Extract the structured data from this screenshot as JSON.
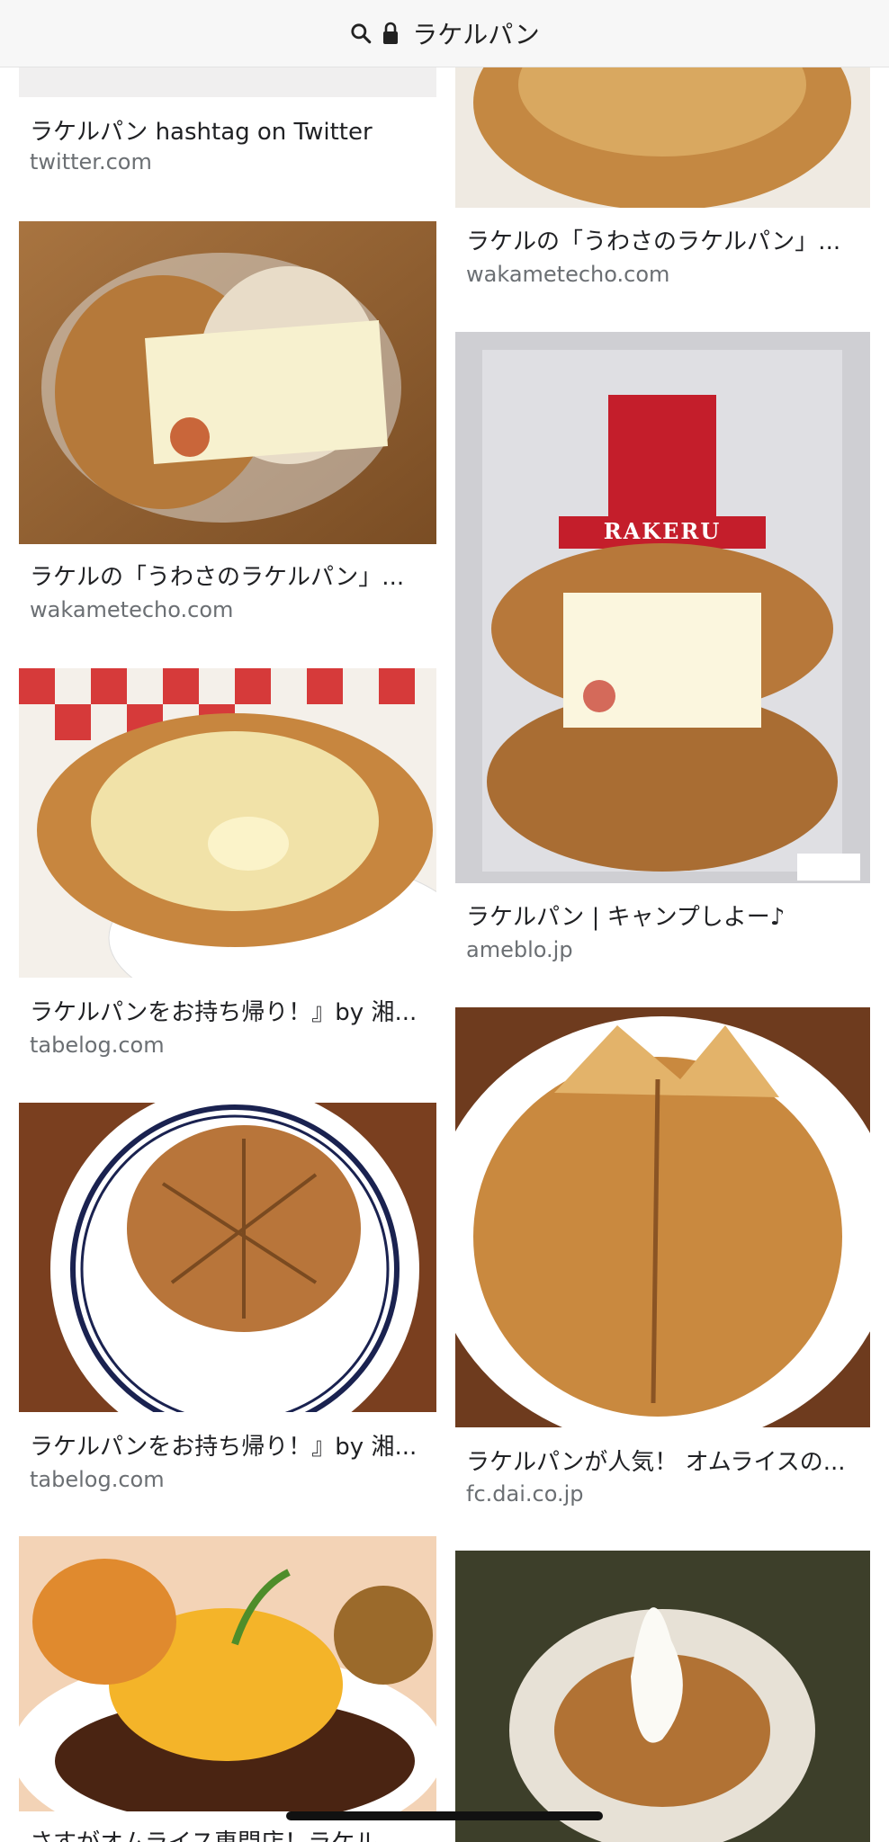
{
  "search": {
    "query": "ラケルパン"
  },
  "results": [
    {
      "title": "ラケルパン hashtag on Twitter",
      "site": "twitter.com"
    },
    {
      "title": "ラケルの「うわさのラケルパン」...",
      "site": "wakametecho.com"
    },
    {
      "title": "ラケルの「うわさのラケルパン」...",
      "site": "wakametecho.com"
    },
    {
      "title": "ラケルパン | キャンプしよー♪",
      "site": "ameblo.jp"
    },
    {
      "title": "ラケルパンをお持ち帰り！』by 湘...",
      "site": "tabelog.com"
    },
    {
      "title": "ラケルパンが人気！ オムライスの...",
      "site": "fc.dai.co.jp"
    },
    {
      "title": "ラケルパンをお持ち帰り！』by 湘...",
      "site": "tabelog.com"
    },
    {
      "title": "さすがオムライス専門店！ラケル...",
      "site": ""
    }
  ],
  "package_label": {
    "brand": "RAKERU"
  },
  "colors": {
    "bread": "#c9893f",
    "plate": "#ffffff",
    "table": "#8b5a2b",
    "checker": "#d43c3c"
  }
}
